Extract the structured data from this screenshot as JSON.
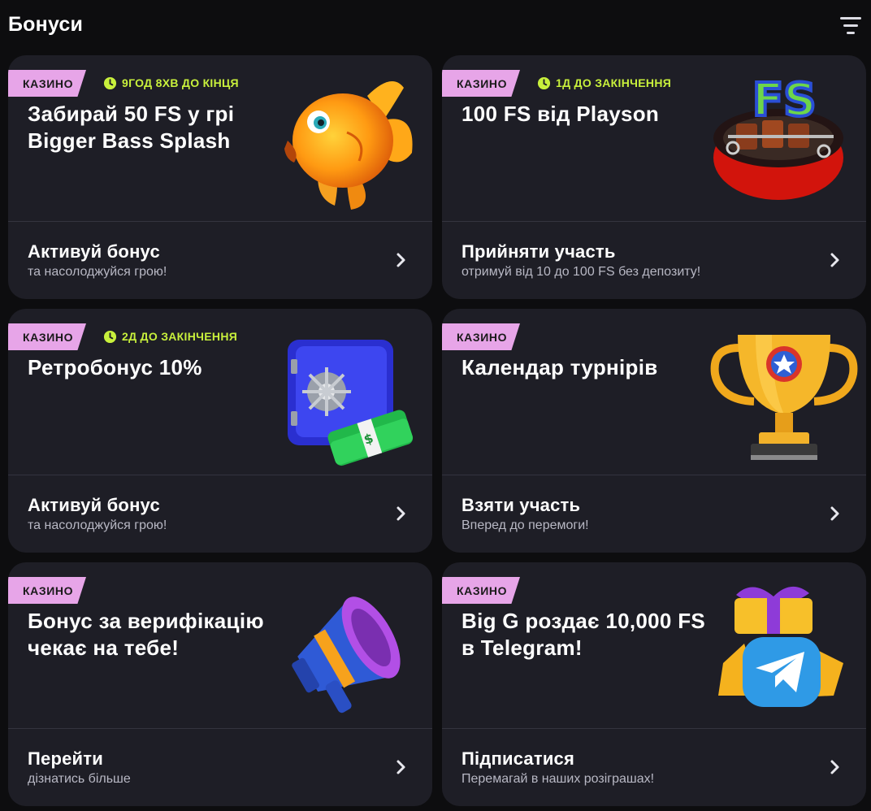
{
  "header": {
    "title": "Бонуси",
    "filter_icon": "filter-icon"
  },
  "colors": {
    "badge": "#e7a5e8",
    "timer": "#c8f03c",
    "card": "#1e1e26",
    "background": "#0d0d0f"
  },
  "cards": [
    {
      "badge": "КАЗИНО",
      "timer": "9ГОД 8ХВ ДО КІНЦЯ",
      "title": "Забирай 50 FS у грі Bigger Bass Splash",
      "action": "Активуй бонус",
      "subtitle": "та насолоджуйся грою!",
      "image": "fish-icon"
    },
    {
      "badge": "КАЗИНО",
      "timer": "1Д ДО ЗАКІНЧЕННЯ",
      "title": "100 FS від Playson",
      "action": "Прийняти участь",
      "subtitle": "отримуй від 10 до 100 FS без депозиту!",
      "image": "fs-grill-icon"
    },
    {
      "badge": "КАЗИНО",
      "timer": "2Д ДО ЗАКІНЧЕННЯ",
      "title": "Ретробонус 10%",
      "action": "Активуй бонус",
      "subtitle": "та насолоджуйся грою!",
      "image": "safe-icon"
    },
    {
      "badge": "КАЗИНО",
      "title": "Календар турнірів",
      "action": "Взяти участь",
      "subtitle": "Вперед до перемоги!",
      "image": "trophy-icon"
    },
    {
      "badge": "КАЗИНО",
      "title": "Бонус за верифікацію чекає на тебе!",
      "action": "Перейти",
      "subtitle": "дізнатись більше",
      "image": "megaphone-icon"
    },
    {
      "badge": "КАЗИНО",
      "title": "Big G роздає 10,000 FS в Telegram!",
      "action": "Підписатися",
      "subtitle": "Перемагай в наших розіграшах!",
      "image": "telegram-gift-icon"
    }
  ]
}
